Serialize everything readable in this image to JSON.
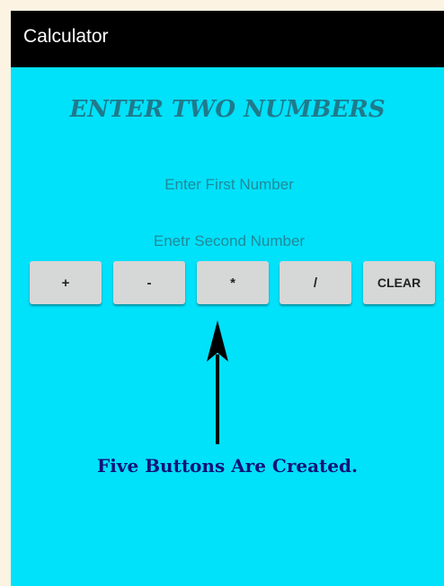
{
  "app_bar": {
    "title": "Calculator"
  },
  "main": {
    "heading": "ENTER TWO NUMBERS",
    "first_number": {
      "value": "",
      "placeholder": "Enter First Number"
    },
    "second_number": {
      "value": "",
      "placeholder": "Enetr Second Number"
    },
    "buttons": [
      {
        "label": "+"
      },
      {
        "label": "-"
      },
      {
        "label": "*"
      },
      {
        "label": "/"
      },
      {
        "label": "CLEAR"
      }
    ]
  },
  "annotation": {
    "caption": "Five Buttons Are Created.",
    "arrow_icon": "up-arrow-icon"
  },
  "colors": {
    "screen_background": "#00e1fa",
    "app_bar": "#000000",
    "heading": "#1f7a8c",
    "hint_text": "#1f8a99",
    "button": "#d6d7d7",
    "caption": "#12127a",
    "page_border": "#fdf3e2"
  }
}
